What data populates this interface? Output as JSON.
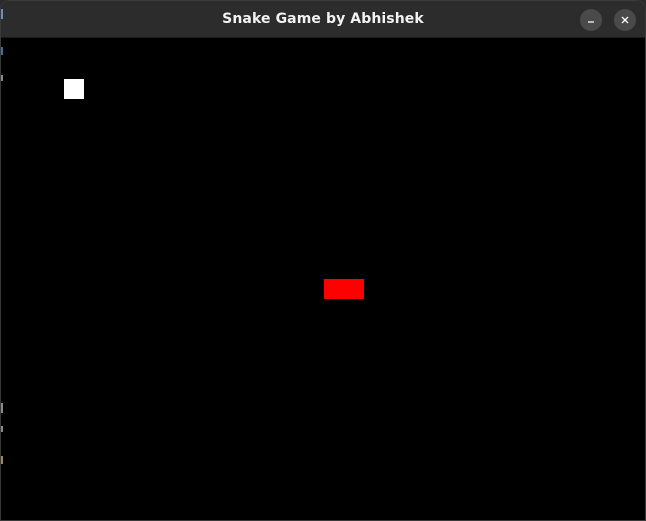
{
  "window": {
    "title": "Snake Game by Abhishek",
    "controls": {
      "minimize_icon": "minimize-icon",
      "close_icon": "close-icon"
    }
  },
  "game": {
    "background_color": "#000000",
    "food": {
      "color": "#ffffff"
    },
    "snake": {
      "color": "#ff0000",
      "segments": 2
    }
  }
}
